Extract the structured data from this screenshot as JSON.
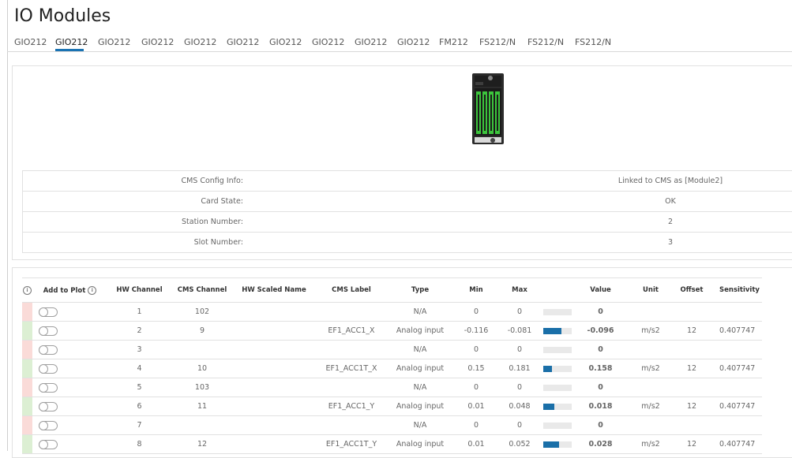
{
  "page": {
    "title": "IO Modules"
  },
  "tabs": [
    "GIO212",
    "GIO212",
    "GIO212",
    "GIO212",
    "GIO212",
    "GIO212",
    "GIO212",
    "GIO212",
    "GIO212",
    "GIO212",
    "FM212",
    "FS212/N",
    "FS212/N",
    "FS212/N"
  ],
  "active_tab_index": 1,
  "info": [
    {
      "label": "CMS Config Info:",
      "value": "Linked to CMS as [Module2]"
    },
    {
      "label": "Card State:",
      "value": "OK"
    },
    {
      "label": "Station Number:",
      "value": "2"
    },
    {
      "label": "Slot Number:",
      "value": "3"
    }
  ],
  "table": {
    "headers": {
      "add_to_plot": "Add to Plot",
      "hw_channel": "HW Channel",
      "cms_channel": "CMS Channel",
      "hw_scaled_name": "HW Scaled Name",
      "cms_label": "CMS Label",
      "type": "Type",
      "min": "Min",
      "max": "Max",
      "value": "Value",
      "unit": "Unit",
      "offset": "Offset",
      "sensitivity": "Sensitivity"
    },
    "rows": [
      {
        "status": "red",
        "hw": "1",
        "cms": "102",
        "scaled": "",
        "label": "",
        "type": "N/A",
        "min": "0",
        "max": "0",
        "level": 0,
        "value": "0",
        "unit": "",
        "offset": "",
        "sens": ""
      },
      {
        "status": "green",
        "hw": "2",
        "cms": "9",
        "scaled": "",
        "label": "EF1_ACC1_X",
        "type": "Analog input",
        "min": "-0.116",
        "max": "-0.081",
        "level": 0.65,
        "value": "-0.096",
        "unit": "m/s2",
        "offset": "12",
        "sens": "0.407747"
      },
      {
        "status": "red",
        "hw": "3",
        "cms": "",
        "scaled": "",
        "label": "",
        "type": "N/A",
        "min": "0",
        "max": "0",
        "level": 0,
        "value": "0",
        "unit": "",
        "offset": "",
        "sens": ""
      },
      {
        "status": "green",
        "hw": "4",
        "cms": "10",
        "scaled": "",
        "label": "EF1_ACC1T_X",
        "type": "Analog input",
        "min": "0.15",
        "max": "0.181",
        "level": 0.3,
        "value": "0.158",
        "unit": "m/s2",
        "offset": "12",
        "sens": "0.407747"
      },
      {
        "status": "red",
        "hw": "5",
        "cms": "103",
        "scaled": "",
        "label": "",
        "type": "N/A",
        "min": "0",
        "max": "0",
        "level": 0,
        "value": "0",
        "unit": "",
        "offset": "",
        "sens": ""
      },
      {
        "status": "green",
        "hw": "6",
        "cms": "11",
        "scaled": "",
        "label": "EF1_ACC1_Y",
        "type": "Analog input",
        "min": "0.01",
        "max": "0.048",
        "level": 0.4,
        "value": "0.018",
        "unit": "m/s2",
        "offset": "12",
        "sens": "0.407747"
      },
      {
        "status": "red",
        "hw": "7",
        "cms": "",
        "scaled": "",
        "label": "",
        "type": "N/A",
        "min": "0",
        "max": "0",
        "level": 0,
        "value": "0",
        "unit": "",
        "offset": "",
        "sens": ""
      },
      {
        "status": "green",
        "hw": "8",
        "cms": "12",
        "scaled": "",
        "label": "EF1_ACC1T_Y",
        "type": "Analog input",
        "min": "0.01",
        "max": "0.052",
        "level": 0.55,
        "value": "0.028",
        "unit": "m/s2",
        "offset": "12",
        "sens": "0.407747"
      }
    ]
  },
  "colors": {
    "accent": "#1a73b3",
    "bar_fill": "#1a6fa8",
    "status_red": "#fadbd8",
    "status_green": "#dcefd3"
  }
}
